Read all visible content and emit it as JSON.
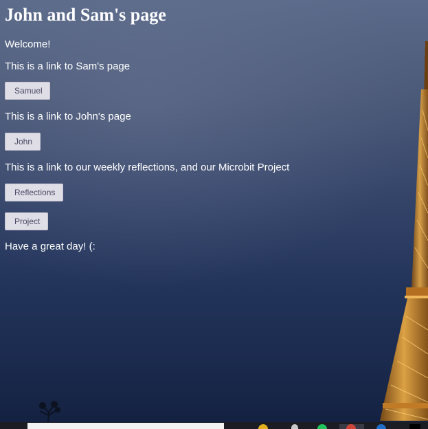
{
  "page": {
    "title": "John and Sam's page",
    "welcome": "Welcome!",
    "sam_link_text": "This is a link to Sam's page",
    "sam_button": "Samuel",
    "john_link_text": "This is a link to John's page",
    "john_button": "John",
    "reflections_text": "This is a link to our weekly reflections, and our Microbit Project",
    "reflections_button": "Reflections",
    "project_button": "Project",
    "closing": "Have a great day! (:"
  },
  "colors": {
    "text": "#ffffff",
    "button_bg": "#dfdde6",
    "button_text": "#4a4a66",
    "taskbar": "#1c1c24"
  },
  "taskbar": {
    "icons": [
      "search-box",
      "chrome-icon",
      "file-explorer-icon",
      "spotify-icon",
      "app-icon",
      "store-icon",
      "terminal-icon"
    ]
  }
}
